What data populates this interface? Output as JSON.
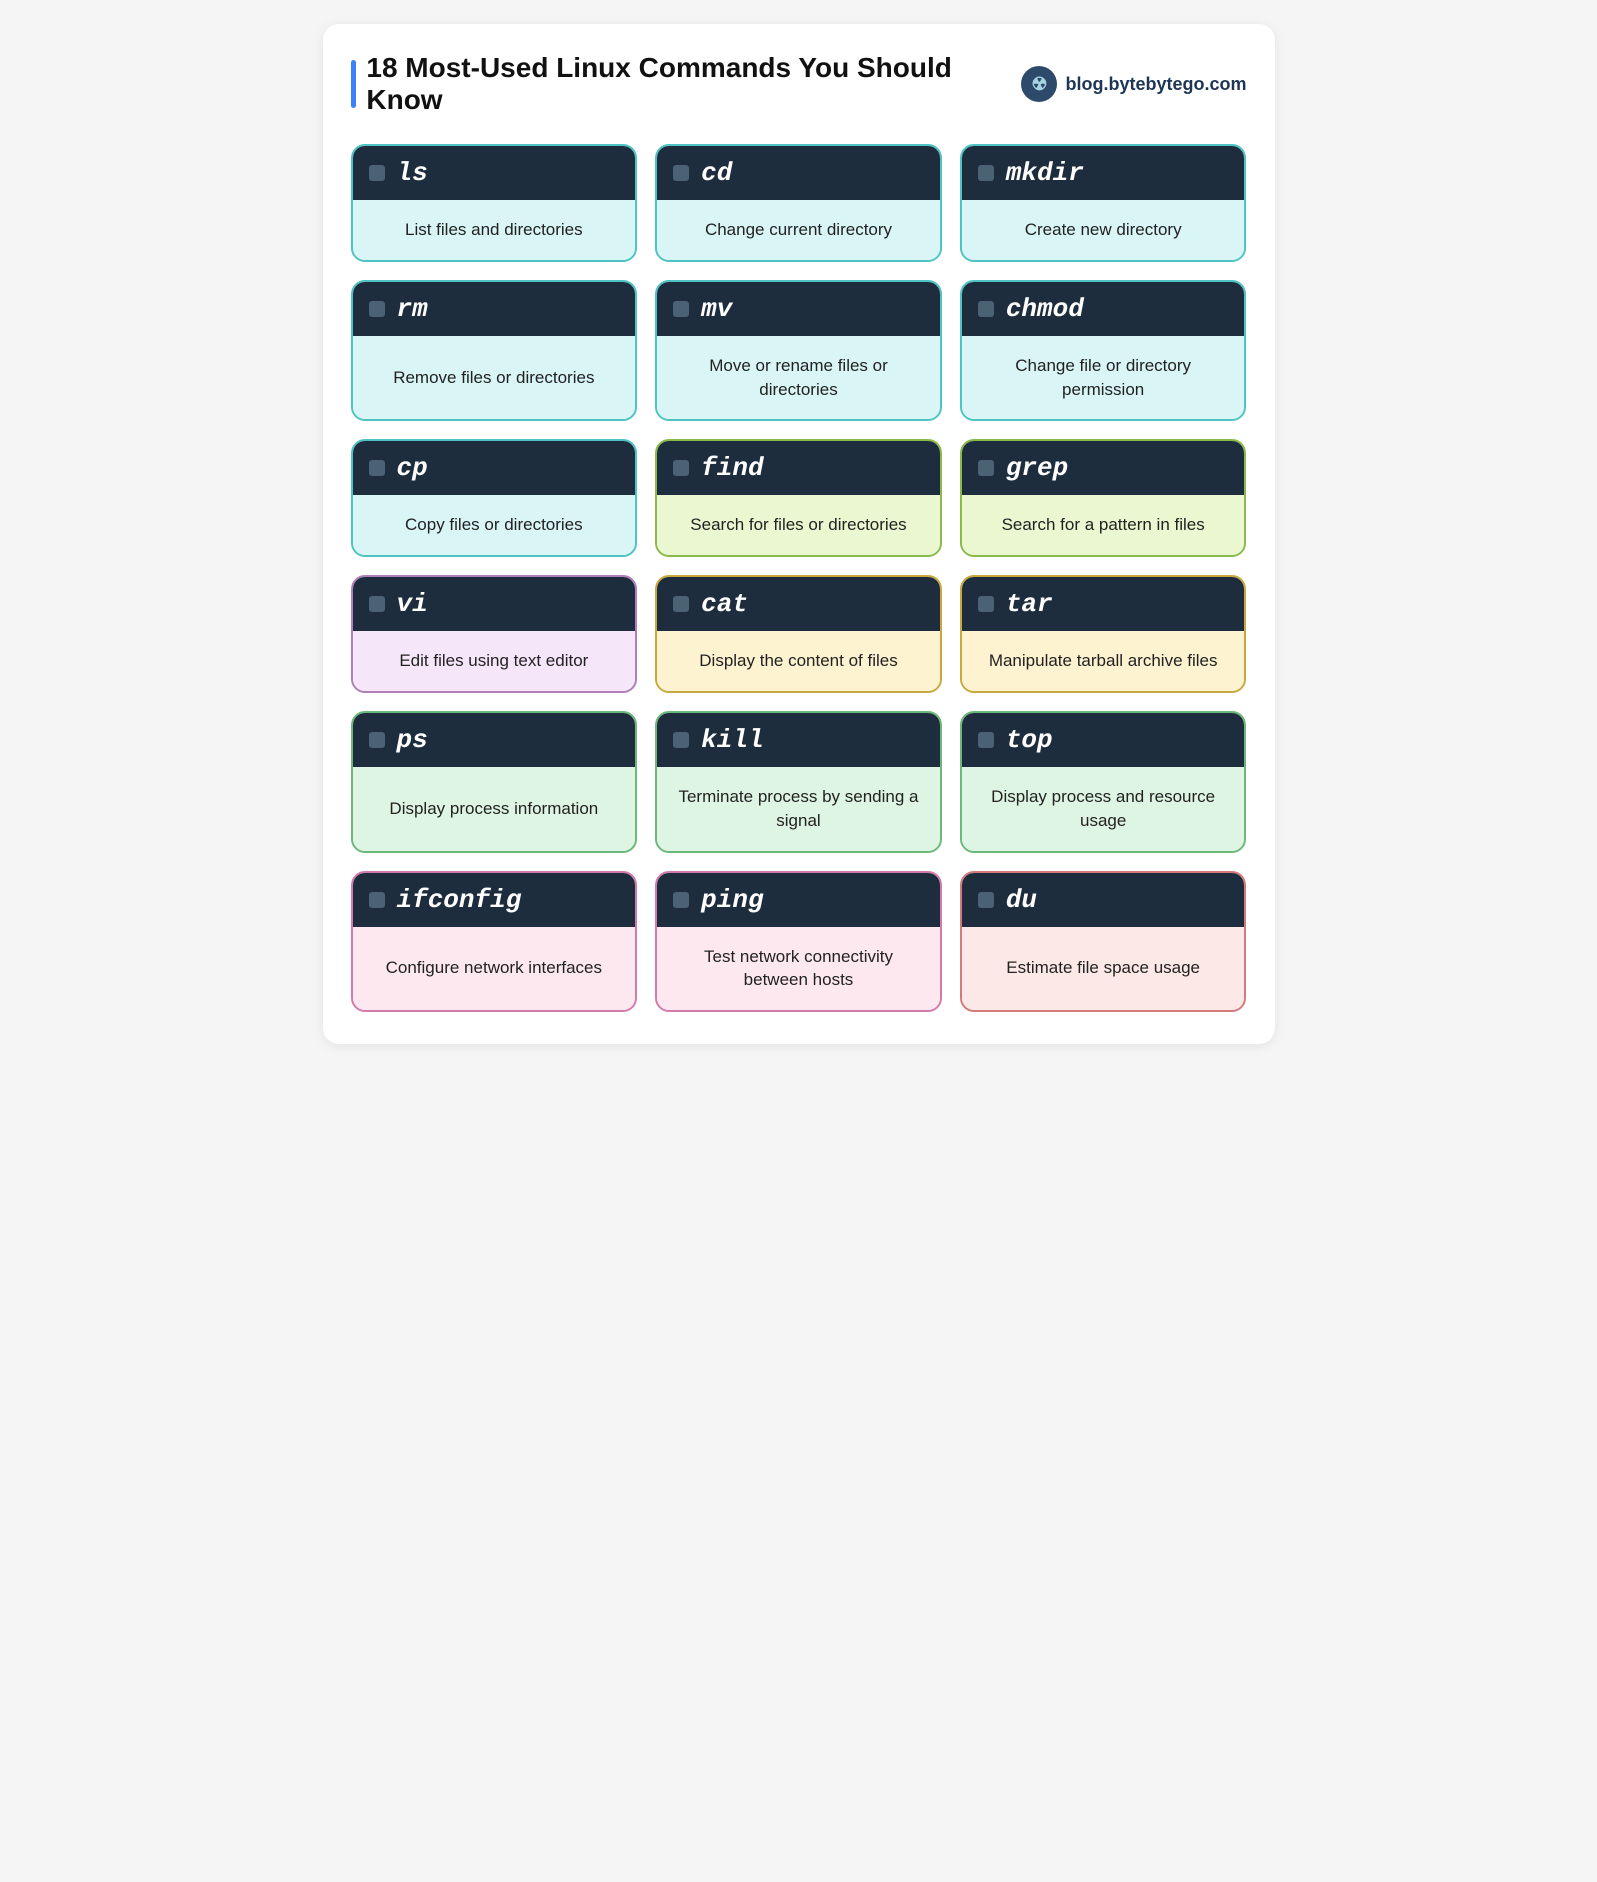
{
  "header": {
    "accent": "#3b82f6",
    "title": "18 Most-Used Linux Commands You Should Know",
    "logo_text": "blog.bytebytego.com"
  },
  "commands": [
    {
      "id": "ls",
      "command": "ls",
      "description": "List files and directories",
      "color": "blue"
    },
    {
      "id": "cd",
      "command": "cd",
      "description": "Change current directory",
      "color": "blue"
    },
    {
      "id": "mkdir",
      "command": "mkdir",
      "description": "Create new directory",
      "color": "blue"
    },
    {
      "id": "rm",
      "command": "rm",
      "description": "Remove files or directories",
      "color": "blue"
    },
    {
      "id": "mv",
      "command": "mv",
      "description": "Move or rename files or directories",
      "color": "blue"
    },
    {
      "id": "chmod",
      "command": "chmod",
      "description": "Change file or directory permission",
      "color": "blue"
    },
    {
      "id": "cp",
      "command": "cp",
      "description": "Copy files or directories",
      "color": "blue"
    },
    {
      "id": "find",
      "command": "find",
      "description": "Search for files or directories",
      "color": "lime"
    },
    {
      "id": "grep",
      "command": "grep",
      "description": "Search for a pattern in files",
      "color": "lime"
    },
    {
      "id": "vi",
      "command": "vi",
      "description": "Edit files using text editor",
      "color": "purple"
    },
    {
      "id": "cat",
      "command": "cat",
      "description": "Display the content of files",
      "color": "yellow"
    },
    {
      "id": "tar",
      "command": "tar",
      "description": "Manipulate tarball archive files",
      "color": "yellow"
    },
    {
      "id": "ps",
      "command": "ps",
      "description": "Display process information",
      "color": "green"
    },
    {
      "id": "kill",
      "command": "kill",
      "description": "Terminate process by sending a signal",
      "color": "green"
    },
    {
      "id": "top",
      "command": "top",
      "description": "Display process and resource usage",
      "color": "green"
    },
    {
      "id": "ifconfig",
      "command": "ifconfig",
      "description": "Configure network interfaces",
      "color": "pink"
    },
    {
      "id": "ping",
      "command": "ping",
      "description": "Test network connectivity between hosts",
      "color": "pink"
    },
    {
      "id": "du",
      "command": "du",
      "description": "Estimate file space usage",
      "color": "red"
    }
  ]
}
